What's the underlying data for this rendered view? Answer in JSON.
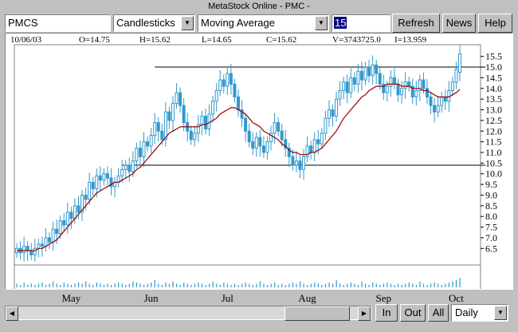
{
  "window": {
    "title": "MetaStock Online - PMC -"
  },
  "toolbar": {
    "symbol": "PMCS",
    "chart_type": "Candlesticks",
    "indicator": "Moving Average",
    "period": "15",
    "refresh_label": "Refresh",
    "news_label": "News",
    "help_label": "Help"
  },
  "info": {
    "date": "10/06/03",
    "open": "O=14.75",
    "high": "H=15.62",
    "low": "L=14.65",
    "close": "C=15.62",
    "volume": "V=3743725.0",
    "indicator": "I=13.959"
  },
  "bottom": {
    "in_label": "In",
    "out_label": "Out",
    "all_label": "All",
    "period_select": "Daily"
  },
  "colors": {
    "candle": "#3399cc",
    "ma": "#990000",
    "resistance": "#000000"
  },
  "icons": {
    "dropdown": "chevron-down-icon",
    "scroll_left": "arrow-left-icon",
    "scroll_right": "arrow-right-icon"
  },
  "chart_data": {
    "type": "candlestick",
    "x_labels": [
      "May",
      "Jun",
      "Jul",
      "Aug",
      "Sep",
      "Oct"
    ],
    "x_label_index": [
      15,
      37,
      58,
      80,
      101,
      121
    ],
    "y_ticks": [
      6.5,
      7.0,
      7.5,
      8.0,
      8.5,
      9.0,
      9.5,
      10.0,
      10.5,
      11.0,
      11.5,
      12.0,
      12.5,
      13.0,
      13.5,
      14.0,
      14.5,
      15.0,
      15.5
    ],
    "ylim": [
      5.8,
      15.9
    ],
    "resistance_lines": [
      {
        "from_index": 38,
        "to_index": 126,
        "value": 15.0
      },
      {
        "from_index": 29,
        "to_index": 126,
        "value": 10.4
      }
    ],
    "close": [
      6.5,
      6.3,
      6.6,
      6.4,
      6.2,
      6.5,
      6.7,
      6.6,
      7.0,
      6.8,
      7.4,
      7.2,
      7.8,
      7.6,
      8.2,
      7.9,
      8.5,
      8.2,
      9.0,
      8.8,
      9.6,
      9.3,
      9.9,
      9.7,
      10.0,
      9.8,
      9.4,
      9.6,
      9.9,
      10.2,
      10.4,
      10.1,
      10.6,
      11.2,
      10.8,
      11.5,
      11.3,
      11.8,
      12.4,
      12.0,
      11.6,
      12.9,
      12.5,
      13.3,
      13.8,
      13.2,
      12.4,
      12.0,
      11.6,
      11.9,
      12.3,
      12.7,
      12.1,
      12.8,
      13.4,
      13.9,
      14.4,
      14.1,
      14.7,
      14.2,
      13.6,
      13.0,
      12.6,
      12.0,
      11.5,
      11.2,
      11.7,
      11.3,
      11.0,
      11.5,
      11.9,
      12.4,
      12.0,
      11.6,
      11.2,
      10.8,
      10.4,
      10.6,
      10.2,
      10.8,
      11.3,
      11.0,
      11.6,
      11.4,
      11.9,
      12.6,
      13.0,
      12.7,
      13.5,
      13.9,
      14.3,
      13.8,
      14.5,
      14.2,
      14.8,
      14.4,
      15.0,
      14.6,
      15.1,
      14.7,
      14.2,
      13.8,
      14.1,
      14.5,
      14.2,
      13.7,
      14.0,
      14.3,
      14.1,
      13.6,
      13.9,
      14.4,
      14.0,
      13.6,
      13.2,
      12.9,
      13.2,
      13.6,
      13.4,
      13.9,
      14.3,
      14.9,
      15.62
    ],
    "open": [
      6.3,
      6.5,
      6.3,
      6.6,
      6.4,
      6.2,
      6.5,
      6.7,
      6.6,
      7.0,
      6.8,
      7.4,
      7.2,
      7.8,
      7.6,
      8.2,
      7.9,
      8.5,
      8.2,
      9.0,
      8.8,
      9.6,
      9.3,
      9.9,
      9.7,
      10.0,
      9.8,
      9.4,
      9.6,
      9.9,
      10.2,
      10.4,
      10.1,
      10.6,
      11.2,
      10.8,
      11.5,
      11.3,
      11.8,
      12.4,
      12.0,
      11.6,
      12.9,
      12.5,
      13.3,
      13.8,
      13.2,
      12.4,
      12.0,
      11.6,
      11.9,
      12.3,
      12.7,
      12.1,
      12.8,
      13.4,
      13.9,
      14.4,
      14.1,
      14.7,
      14.2,
      13.6,
      13.0,
      12.6,
      12.0,
      11.5,
      11.2,
      11.7,
      11.3,
      11.0,
      11.5,
      11.9,
      12.4,
      12.0,
      11.6,
      11.2,
      10.8,
      10.4,
      10.6,
      10.2,
      10.8,
      11.3,
      11.0,
      11.6,
      11.4,
      11.9,
      12.6,
      13.0,
      12.7,
      13.5,
      13.9,
      14.3,
      13.8,
      14.5,
      14.2,
      14.8,
      14.4,
      15.0,
      14.6,
      15.1,
      14.7,
      14.2,
      13.8,
      14.1,
      14.5,
      14.2,
      13.7,
      14.0,
      14.3,
      14.1,
      13.6,
      13.9,
      14.4,
      14.0,
      13.6,
      13.2,
      12.9,
      13.2,
      13.6,
      13.4,
      13.9,
      14.3,
      14.75
    ],
    "moving_average": [
      6.4,
      6.4,
      6.4,
      6.4,
      6.4,
      6.4,
      6.5,
      6.5,
      6.6,
      6.7,
      6.8,
      6.9,
      7.1,
      7.3,
      7.5,
      7.7,
      7.9,
      8.1,
      8.3,
      8.5,
      8.7,
      8.9,
      9.1,
      9.2,
      9.3,
      9.4,
      9.5,
      9.6,
      9.6,
      9.7,
      9.8,
      9.9,
      10.0,
      10.2,
      10.3,
      10.5,
      10.7,
      10.9,
      11.1,
      11.3,
      11.5,
      11.7,
      11.9,
      12.0,
      12.1,
      12.2,
      12.2,
      12.2,
      12.2,
      12.2,
      12.2,
      12.3,
      12.3,
      12.4,
      12.5,
      12.6,
      12.8,
      12.9,
      13.0,
      13.1,
      13.1,
      13.0,
      12.9,
      12.8,
      12.6,
      12.4,
      12.3,
      12.2,
      12.0,
      11.9,
      11.8,
      11.7,
      11.6,
      11.4,
      11.3,
      11.1,
      11.0,
      11.0,
      10.9,
      10.9,
      10.9,
      11.0,
      11.0,
      11.1,
      11.2,
      11.4,
      11.6,
      11.8,
      12.0,
      12.3,
      12.6,
      12.8,
      13.0,
      13.2,
      13.4,
      13.6,
      13.7,
      13.9,
      14.0,
      14.1,
      14.1,
      14.1,
      14.2,
      14.2,
      14.2,
      14.2,
      14.1,
      14.1,
      14.1,
      14.0,
      14.0,
      14.0,
      13.9,
      13.9,
      13.8,
      13.7,
      13.6,
      13.6,
      13.6,
      13.6,
      13.7,
      13.8,
      13.96
    ],
    "volume": [
      3,
      2,
      4,
      2,
      3,
      2,
      3,
      4,
      2,
      3,
      5,
      3,
      2,
      4,
      3,
      2,
      3,
      4,
      3,
      5,
      3,
      2,
      4,
      3,
      2,
      3,
      2,
      3,
      4,
      3,
      2,
      3,
      5,
      4,
      3,
      2,
      3,
      4,
      6,
      3,
      2,
      4,
      3,
      5,
      3,
      2,
      4,
      3,
      2,
      3,
      4,
      3,
      2,
      3,
      5,
      3,
      2,
      4,
      3,
      2,
      3,
      2,
      3,
      4,
      3,
      2,
      3,
      5,
      3,
      2,
      3,
      4,
      2,
      3,
      2,
      3,
      4,
      3,
      5,
      3,
      2,
      3,
      4,
      3,
      2,
      3,
      4,
      3,
      6,
      3,
      2,
      3,
      4,
      3,
      2,
      5,
      3,
      2,
      4,
      3,
      2,
      3,
      4,
      3,
      2,
      3,
      2,
      3,
      4,
      3,
      2,
      5,
      3,
      2,
      3,
      4,
      3,
      2,
      3,
      4,
      5,
      6,
      8
    ]
  }
}
